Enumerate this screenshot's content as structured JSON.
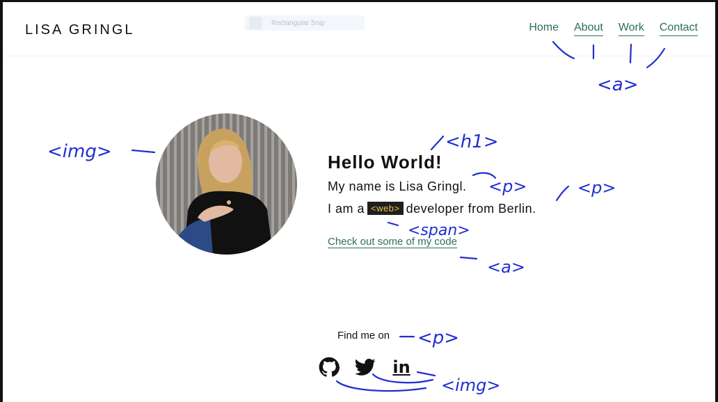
{
  "header": {
    "brand": "LISA GRINGL",
    "snip_label": "Rectangular Snip",
    "nav": [
      {
        "label": "Home"
      },
      {
        "label": "About"
      },
      {
        "label": "Work"
      },
      {
        "label": "Contact"
      }
    ]
  },
  "intro": {
    "heading": "Hello World!",
    "line1": "My name is Lisa Gringl.",
    "line2_before": "I am a",
    "tag": "<web>",
    "line2_after": "developer from Berlin.",
    "link": "Check out some of my code"
  },
  "footer": {
    "find_text": "Find me on",
    "social": [
      {
        "icon": "github-icon"
      },
      {
        "icon": "twitter-icon"
      },
      {
        "icon": "linkedin-icon",
        "text": "in"
      }
    ]
  },
  "annotations": {
    "a_nav": "<a>",
    "img": "<img>",
    "h1": "<h1>",
    "p1": "<p>",
    "p2": "<p>",
    "span": "<span>",
    "a_link": "<a>",
    "p_find": "<p>",
    "img_social": "<img>"
  },
  "colors": {
    "link": "#2c6e5a",
    "annotation": "#1f2fd0",
    "tag_bg": "#1f1f1f",
    "tag_text": "#f0c24b"
  }
}
